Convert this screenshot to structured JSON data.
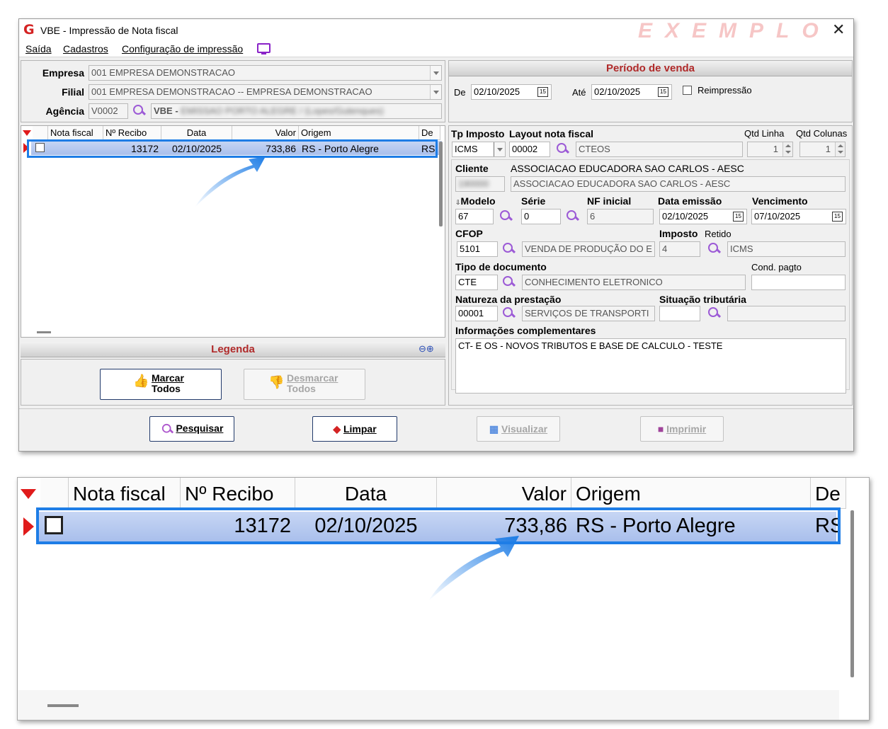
{
  "window": {
    "title": "VBE - Impressão de Nota fiscal",
    "watermark": "EXEMPLO",
    "menu": [
      "Saída",
      "Cadastros",
      "Configuração de impressão"
    ]
  },
  "header": {
    "empresa_label": "Empresa",
    "empresa_value": "001 EMPRESA DEMONSTRACAO",
    "filial_label": "Filial",
    "filial_value": "001 EMPRESA DEMONSTRACAO -- EMPRESA DEMONSTRACAO",
    "agencia_label": "Agência",
    "agencia_code": "V0002",
    "agencia_desc_prefix": "VBE -",
    "agencia_desc_blurred": "EMISSAO PORTO ALEGRE / (Lopes/Gutenques)"
  },
  "periodo": {
    "title": "Período de venda",
    "de_label": "De",
    "de_value": "02/10/2025",
    "ate_label": "Até",
    "ate_value": "02/10/2025",
    "reimpressao_label": "Reimpressão"
  },
  "grid": {
    "columns": [
      "Nota fiscal",
      "Nº Recibo",
      "Data",
      "Valor",
      "Origem",
      "De"
    ],
    "row": {
      "nota_fiscal": "",
      "recibo": "13172",
      "data": "02/10/2025",
      "valor": "733,86",
      "origem": "RS - Porto Alegre",
      "destino": "RS"
    }
  },
  "legenda": {
    "title": "Legenda"
  },
  "buttons": {
    "marcar_1": "Marcar",
    "marcar_2": "Todos",
    "desmarcar_1": "Desmarcar",
    "desmarcar_2": "Todos",
    "pesquisar": "Pesquisar",
    "limpar": "Limpar",
    "visualizar": "Visualizar",
    "imprimir": "Imprimir"
  },
  "form": {
    "tp_imposto_label": "Tp Imposto",
    "tp_imposto_value": "ICMS",
    "layout_label": "Layout nota fiscal",
    "layout_code": "00002",
    "layout_desc": "CTEOS",
    "qtd_linha_label": "Qtd Linha",
    "qtd_linha_value": "1",
    "qtd_colunas_label": "Qtd Colunas",
    "qtd_colunas_value": "1",
    "cliente_label": "Cliente",
    "cliente_name": "ASSOCIACAO EDUCADORA SAO CARLOS - AESC",
    "cliente_code_blurred": "190000",
    "cliente_desc": "ASSOCIACAO EDUCADORA SAO CARLOS - AESC",
    "modelo_label": "Modelo",
    "modelo_value": "67",
    "serie_label": "Série",
    "serie_value": "0",
    "nf_inicial_label": "NF inicial",
    "nf_inicial_value": "6",
    "data_emissao_label": "Data emissão",
    "data_emissao_value": "02/10/2025",
    "vencimento_label": "Vencimento",
    "vencimento_value": "07/10/2025",
    "cfop_label": "CFOP",
    "cfop_value": "5101",
    "cfop_desc": "VENDA DE PRODUÇÃO DO E",
    "imposto_label": "Imposto",
    "retido_label": "Retido",
    "imposto_value": "4",
    "imposto_desc": "ICMS",
    "tipo_doc_label": "Tipo de documento",
    "tipo_doc_value": "CTE",
    "tipo_doc_desc": "CONHECIMENTO ELETRONICO",
    "cond_pagto_label": "Cond. pagto",
    "natureza_label": "Natureza da prestação",
    "natureza_value": "00001",
    "natureza_desc": "SERVIÇOS DE TRANSPORTI",
    "situacao_label": "Situação tributária",
    "info_label": "Informações complementares",
    "info_value": "CT- E OS  - NOVOS TRIBUTOS E BASE DE CALCULO - TESTE"
  },
  "colors": {
    "accent_red": "#b02a2a",
    "highlight_blue": "#1e7de6",
    "icon_purple": "#9c5ad6"
  }
}
